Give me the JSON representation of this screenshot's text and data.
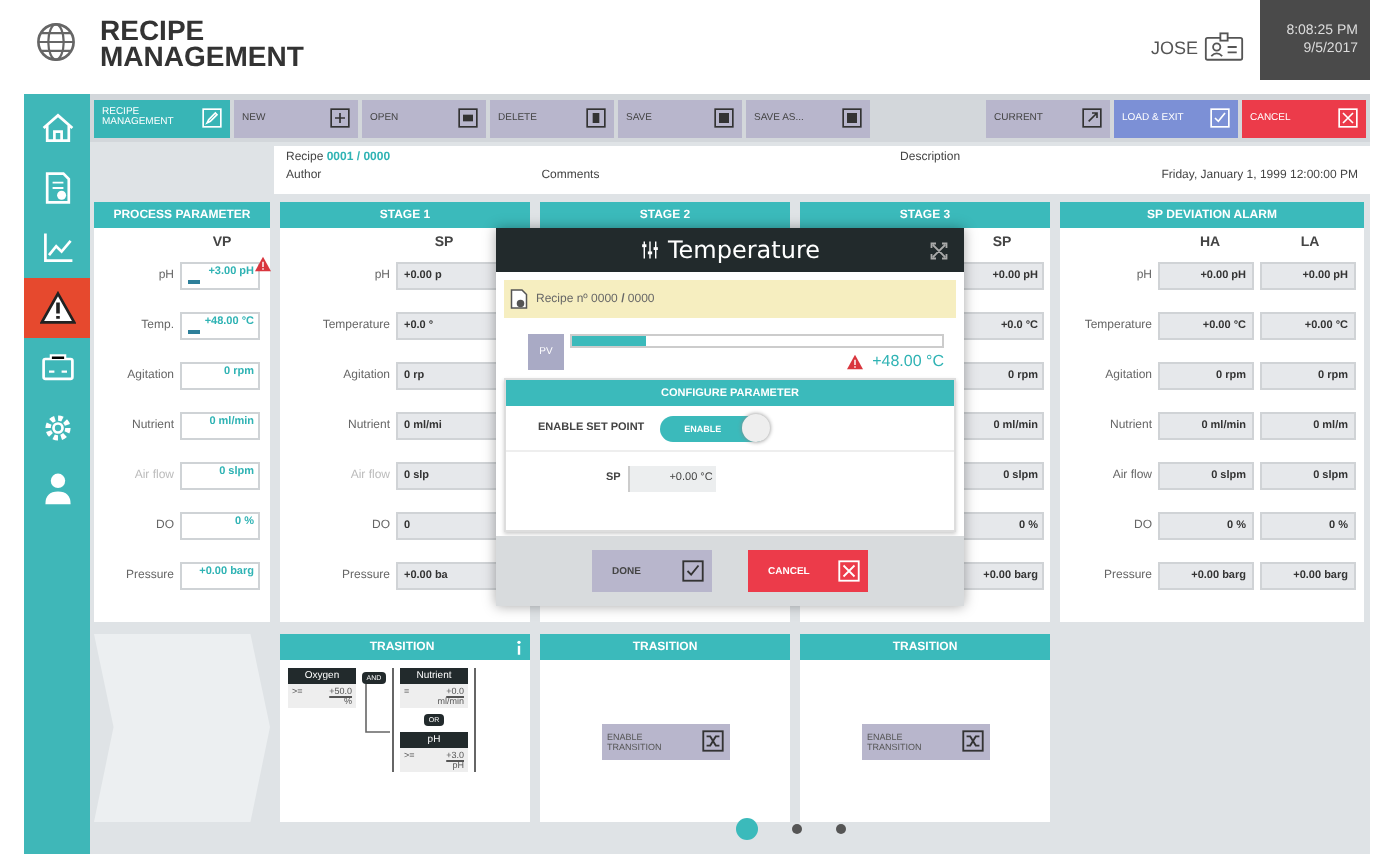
{
  "header": {
    "title_line1": "RECIPE",
    "title_line2": "MANAGEMENT",
    "user": "JOSE",
    "time": "8:08:25 PM",
    "date": "9/5/2017"
  },
  "sidebar": {
    "items": [
      {
        "selected": false
      },
      {
        "selected": false
      },
      {
        "selected": false
      },
      {
        "selected": true
      },
      {
        "selected": false
      },
      {
        "selected": false
      },
      {
        "selected": false
      }
    ]
  },
  "toolbar": {
    "buttons": [
      {
        "label": "RECIPE MANAGEMENT",
        "kind": "nav",
        "selected": true
      },
      {
        "label": "NEW",
        "kind": "action",
        "selected": false
      },
      {
        "label": "OPEN",
        "kind": "action",
        "selected": false
      },
      {
        "label": "DELETE",
        "kind": "action",
        "selected": false
      },
      {
        "label": "SAVE",
        "kind": "action",
        "selected": false
      },
      {
        "label": "SAVE AS...",
        "kind": "action",
        "selected": false
      },
      {
        "label": "CURRENT",
        "kind": "action",
        "selected": false
      },
      {
        "label": "LOAD & EXIT",
        "kind": "confirm",
        "selected": false
      },
      {
        "label": "CANCEL",
        "kind": "cancel",
        "selected": false
      }
    ]
  },
  "recipe_info": {
    "recipe_label": "Recipe",
    "recipe_number": "0001 / 0000",
    "author_label": "Author",
    "comments_label": "Comments",
    "description_label": "Description",
    "date": "Friday, January 1, 1999 12:00:00 PM"
  },
  "process_parameter": {
    "title": "PROCESS PARAMETER",
    "column": "VP",
    "rows": [
      {
        "label": "pH",
        "value": "+3.00 pH",
        "disabled": false,
        "level": 0.2,
        "alarm": true
      },
      {
        "label": "Temp.",
        "value": "+48.00 °C",
        "disabled": false,
        "level": 0.2,
        "alarm": false
      },
      {
        "label": "Agitation",
        "value": "0 rpm",
        "disabled": false,
        "alarm": false
      },
      {
        "label": "Nutrient",
        "value": "0 ml/min",
        "disabled": false,
        "alarm": false
      },
      {
        "label": "Air flow",
        "value": "0 slpm",
        "disabled": true,
        "alarm": false
      },
      {
        "label": "DO",
        "value": "0 %",
        "disabled": false,
        "alarm": false
      },
      {
        "label": "Pressure",
        "value": "+0.00 barg",
        "disabled": false,
        "alarm": false
      }
    ]
  },
  "stages": [
    {
      "title": "STAGE 1",
      "column": "SP",
      "rows": [
        {
          "label": "pH",
          "value": "+0.00 p",
          "disabled": false
        },
        {
          "label": "Temperature",
          "value": "+0.0 °",
          "disabled": false
        },
        {
          "label": "Agitation",
          "value": "0 rp",
          "disabled": false
        },
        {
          "label": "Nutrient",
          "value": "0 ml/mi",
          "disabled": false
        },
        {
          "label": "Air flow",
          "value": "0 slp",
          "disabled": true
        },
        {
          "label": "DO",
          "value": "0",
          "disabled": false
        },
        {
          "label": "Pressure",
          "value": "+0.00 ba",
          "disabled": false
        }
      ]
    },
    {
      "title": "STAGE 2"
    },
    {
      "title": "STAGE 3",
      "column": "SP",
      "rows": [
        {
          "value": "+0.00 pH"
        },
        {
          "value": "+0.0 °C"
        },
        {
          "value": "0 rpm"
        },
        {
          "value": "0 ml/min"
        },
        {
          "value": "0 slpm"
        },
        {
          "value": "0 %"
        },
        {
          "value": "+0.00 barg"
        }
      ]
    }
  ],
  "sp_deviation_alarm": {
    "title": "SP DEVIATION ALARM",
    "columns": [
      "HA",
      "LA"
    ],
    "rows": [
      {
        "label": "pH",
        "disabled": false,
        "ha": "+0.00 pH",
        "la": "+0.00 pH"
      },
      {
        "label": "Temperature",
        "disabled": false,
        "ha": "+0.00 °C",
        "la": "+0.00 °C"
      },
      {
        "label": "Agitation",
        "disabled": false,
        "ha": "0 rpm",
        "la": "0 rpm"
      },
      {
        "label": "Nutrient",
        "disabled": false,
        "ha": "0 ml/min",
        "la": "0 ml/m"
      },
      {
        "label": "Air flow",
        "disabled": false,
        "ha": "0 slpm",
        "la": "0 slpm"
      },
      {
        "label": "DO",
        "disabled": false,
        "ha": "0 %",
        "la": "0 %"
      },
      {
        "label": "Pressure",
        "disabled": false,
        "ha": "+0.00 barg",
        "la": "+0.00 barg"
      }
    ]
  },
  "transitions": [
    {
      "title": "TRASITION",
      "kind": "logic",
      "conditions": [
        {
          "name": "Oxygen",
          "op": ">=",
          "value": "+50.0",
          "unit": "%"
        },
        {
          "name": "Nutrient",
          "op": "=",
          "value": "+0.0",
          "unit": "ml/min"
        },
        {
          "name": "pH",
          "op": ">=",
          "value": "+3.0",
          "unit": "pH"
        }
      ],
      "operators": [
        "AND",
        "OR"
      ]
    },
    {
      "title": "TRASITION",
      "kind": "button",
      "button": "ENABLE TRANSITION"
    },
    {
      "title": "TRASITION",
      "kind": "button",
      "button": "ENABLE TRANSITION"
    }
  ],
  "pagination": [
    {
      "selected": true
    },
    {
      "selected": false
    },
    {
      "selected": false
    }
  ],
  "dialog": {
    "title": "Temperature",
    "recipe_prefix": "Recipe nº 0000",
    "recipe_sep": "/",
    "recipe_suffix": "0000",
    "pv_label": "PV",
    "level": 0.2,
    "alarm": true,
    "reading": "+48.00 °C",
    "section_title": "CONFIGURE PARAMETER",
    "setpoint_label": "ENABLE SET POINT",
    "toggle": {
      "label": "ENABLE",
      "on": true
    },
    "sp_label": "SP",
    "sp_value": "+0.00 °C",
    "buttons": [
      {
        "label": "DONE",
        "kind": "confirm"
      },
      {
        "label": "CANCEL",
        "kind": "cancel"
      }
    ]
  }
}
